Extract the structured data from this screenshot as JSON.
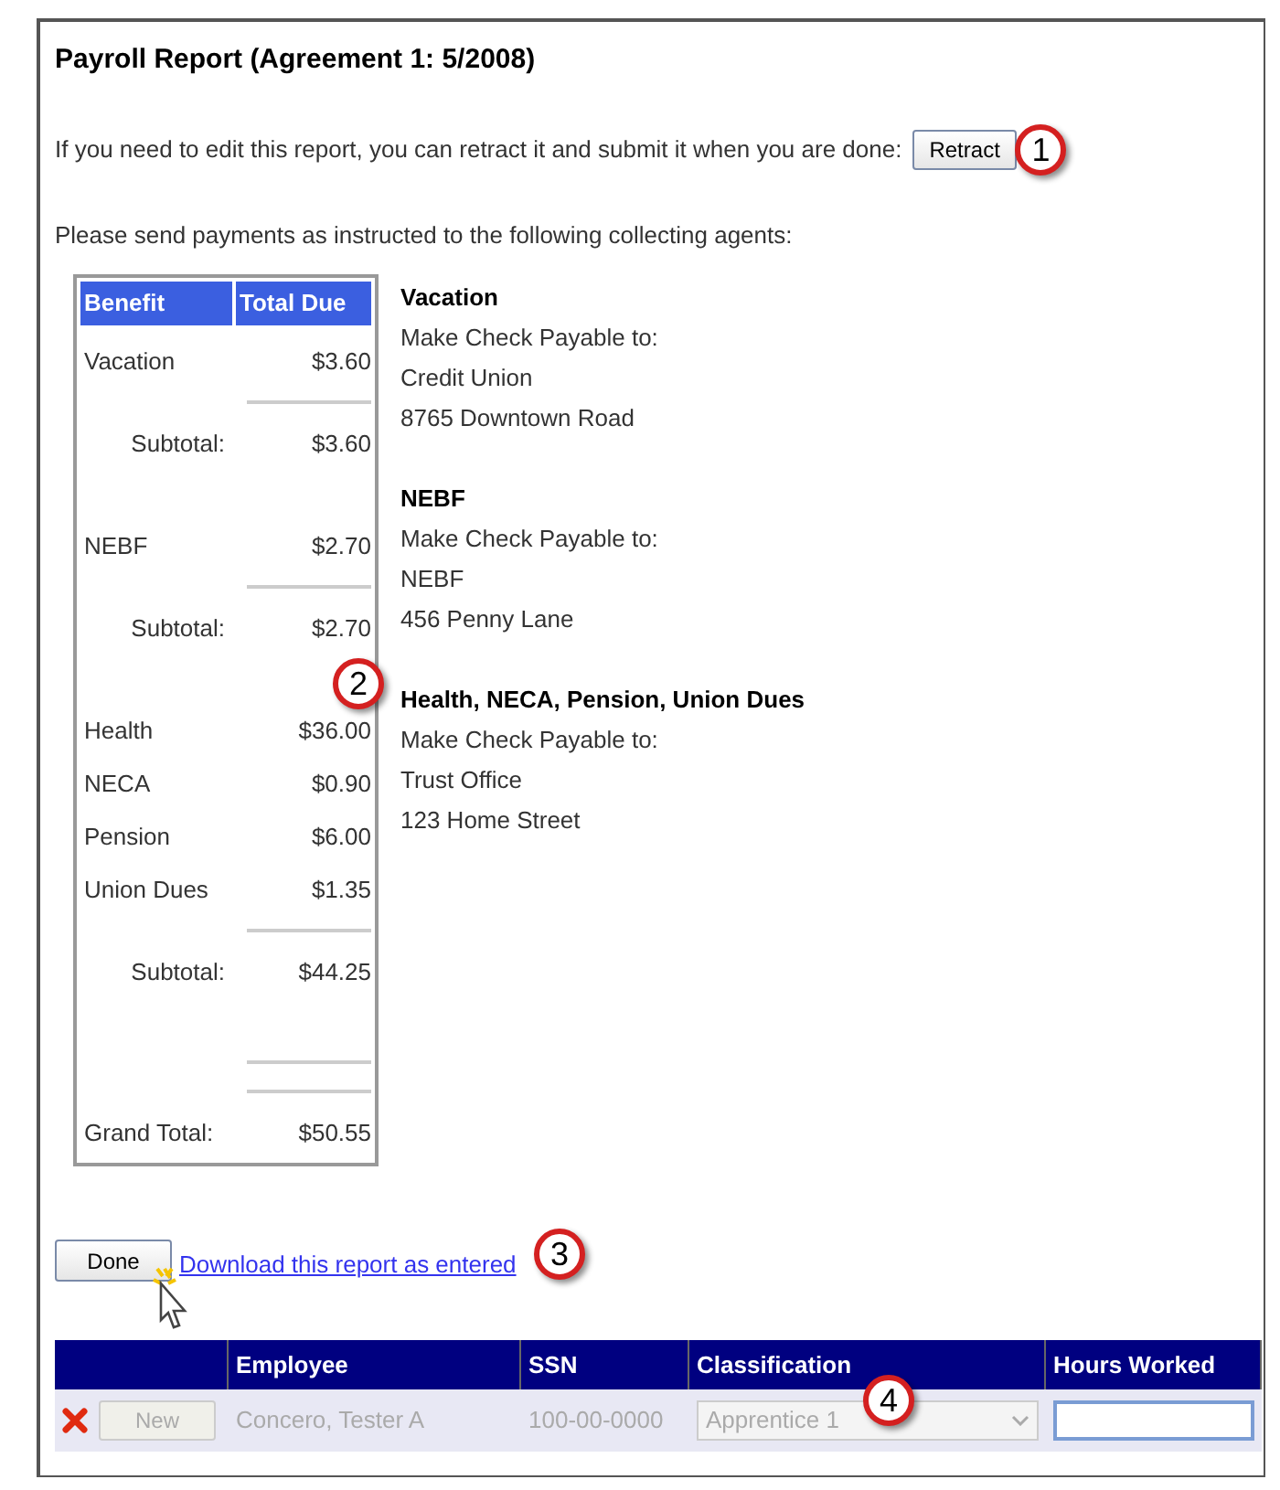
{
  "title": "Payroll Report (Agreement 1: 5/2008)",
  "retract": {
    "text": "If you need to edit this report, you can retract it and submit it when you are done:",
    "button": "Retract"
  },
  "instruction": "Please send payments as instructed to the following collecting agents:",
  "benefits": {
    "columns": [
      "Benefit",
      "Total Due"
    ],
    "rows": [
      {
        "kind": "item",
        "label": "Vacation",
        "amount": "$3.60"
      },
      {
        "kind": "rule"
      },
      {
        "kind": "subtotal",
        "label": "Subtotal:",
        "amount": "$3.60"
      },
      {
        "kind": "spacer"
      },
      {
        "kind": "item",
        "label": "NEBF",
        "amount": "$2.70"
      },
      {
        "kind": "rule"
      },
      {
        "kind": "subtotal",
        "label": "Subtotal:",
        "amount": "$2.70"
      },
      {
        "kind": "spacer"
      },
      {
        "kind": "item",
        "label": "Health",
        "amount": "$36.00"
      },
      {
        "kind": "item",
        "label": "NECA",
        "amount": "$0.90"
      },
      {
        "kind": "item",
        "label": "Pension",
        "amount": "$6.00"
      },
      {
        "kind": "item",
        "label": "Union Dues",
        "amount": "$1.35"
      },
      {
        "kind": "rule"
      },
      {
        "kind": "subtotal",
        "label": "Subtotal:",
        "amount": "$44.25"
      },
      {
        "kind": "spacer"
      },
      {
        "kind": "rule"
      },
      {
        "kind": "rule"
      },
      {
        "kind": "grand_total",
        "label": "Grand Total:",
        "amount": "$50.55"
      }
    ]
  },
  "agents": [
    {
      "name": "Vacation",
      "lines": [
        "Make Check Payable to:",
        "Credit Union",
        "8765 Downtown Road"
      ]
    },
    {
      "name": "NEBF",
      "lines": [
        "Make Check Payable to:",
        "NEBF",
        "456 Penny Lane"
      ]
    },
    {
      "name": "Health, NECA, Pension, Union Dues",
      "lines": [
        "Make Check Payable to:",
        "Trust Office",
        "123 Home Street"
      ]
    }
  ],
  "done_button": "Done",
  "download_link": "Download this report as entered",
  "grid": {
    "columns": [
      "Employee",
      "SSN",
      "Classification",
      "Hours Worked"
    ],
    "rows": [
      {
        "disabled": true,
        "new_button": "New",
        "employee": "Concero, Tester A",
        "ssn": "100-00-0000",
        "classification": "Apprentice 1"
      }
    ]
  },
  "callouts": [
    "1",
    "2",
    "3",
    "4"
  ]
}
